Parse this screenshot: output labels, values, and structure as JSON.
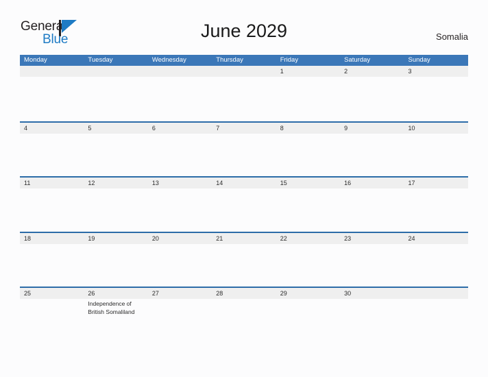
{
  "brand": {
    "name_part1": "General",
    "name_part2": "Blue",
    "flag_icon": "flag-triangle-icon",
    "color_dark": "#231f20",
    "color_blue": "#1e7bc4"
  },
  "header": {
    "title": "June 2029",
    "country": "Somalia"
  },
  "theme": {
    "header_blue": "#3b77b8",
    "rule_blue": "#2c6ca8",
    "date_band_gray": "#efefef",
    "page_background": "#fcfcfd",
    "text_dark": "#2b2b2b"
  },
  "calendar": {
    "month": "June",
    "year": "2029",
    "weekday_headers": [
      "Monday",
      "Tuesday",
      "Wednesday",
      "Thursday",
      "Friday",
      "Saturday",
      "Sunday"
    ],
    "weeks": [
      {
        "days": [
          {
            "date": "",
            "events": []
          },
          {
            "date": "",
            "events": []
          },
          {
            "date": "",
            "events": []
          },
          {
            "date": "",
            "events": []
          },
          {
            "date": "1",
            "events": []
          },
          {
            "date": "2",
            "events": []
          },
          {
            "date": "3",
            "events": []
          }
        ]
      },
      {
        "days": [
          {
            "date": "4",
            "events": []
          },
          {
            "date": "5",
            "events": []
          },
          {
            "date": "6",
            "events": []
          },
          {
            "date": "7",
            "events": []
          },
          {
            "date": "8",
            "events": []
          },
          {
            "date": "9",
            "events": []
          },
          {
            "date": "10",
            "events": []
          }
        ]
      },
      {
        "days": [
          {
            "date": "11",
            "events": []
          },
          {
            "date": "12",
            "events": []
          },
          {
            "date": "13",
            "events": []
          },
          {
            "date": "14",
            "events": []
          },
          {
            "date": "15",
            "events": []
          },
          {
            "date": "16",
            "events": []
          },
          {
            "date": "17",
            "events": []
          }
        ]
      },
      {
        "days": [
          {
            "date": "18",
            "events": []
          },
          {
            "date": "19",
            "events": []
          },
          {
            "date": "20",
            "events": []
          },
          {
            "date": "21",
            "events": []
          },
          {
            "date": "22",
            "events": []
          },
          {
            "date": "23",
            "events": []
          },
          {
            "date": "24",
            "events": []
          }
        ]
      },
      {
        "days": [
          {
            "date": "25",
            "events": []
          },
          {
            "date": "26",
            "events": [
              "Independence of British Somaliland"
            ]
          },
          {
            "date": "27",
            "events": []
          },
          {
            "date": "28",
            "events": []
          },
          {
            "date": "29",
            "events": []
          },
          {
            "date": "30",
            "events": []
          },
          {
            "date": "",
            "events": []
          }
        ]
      }
    ]
  }
}
